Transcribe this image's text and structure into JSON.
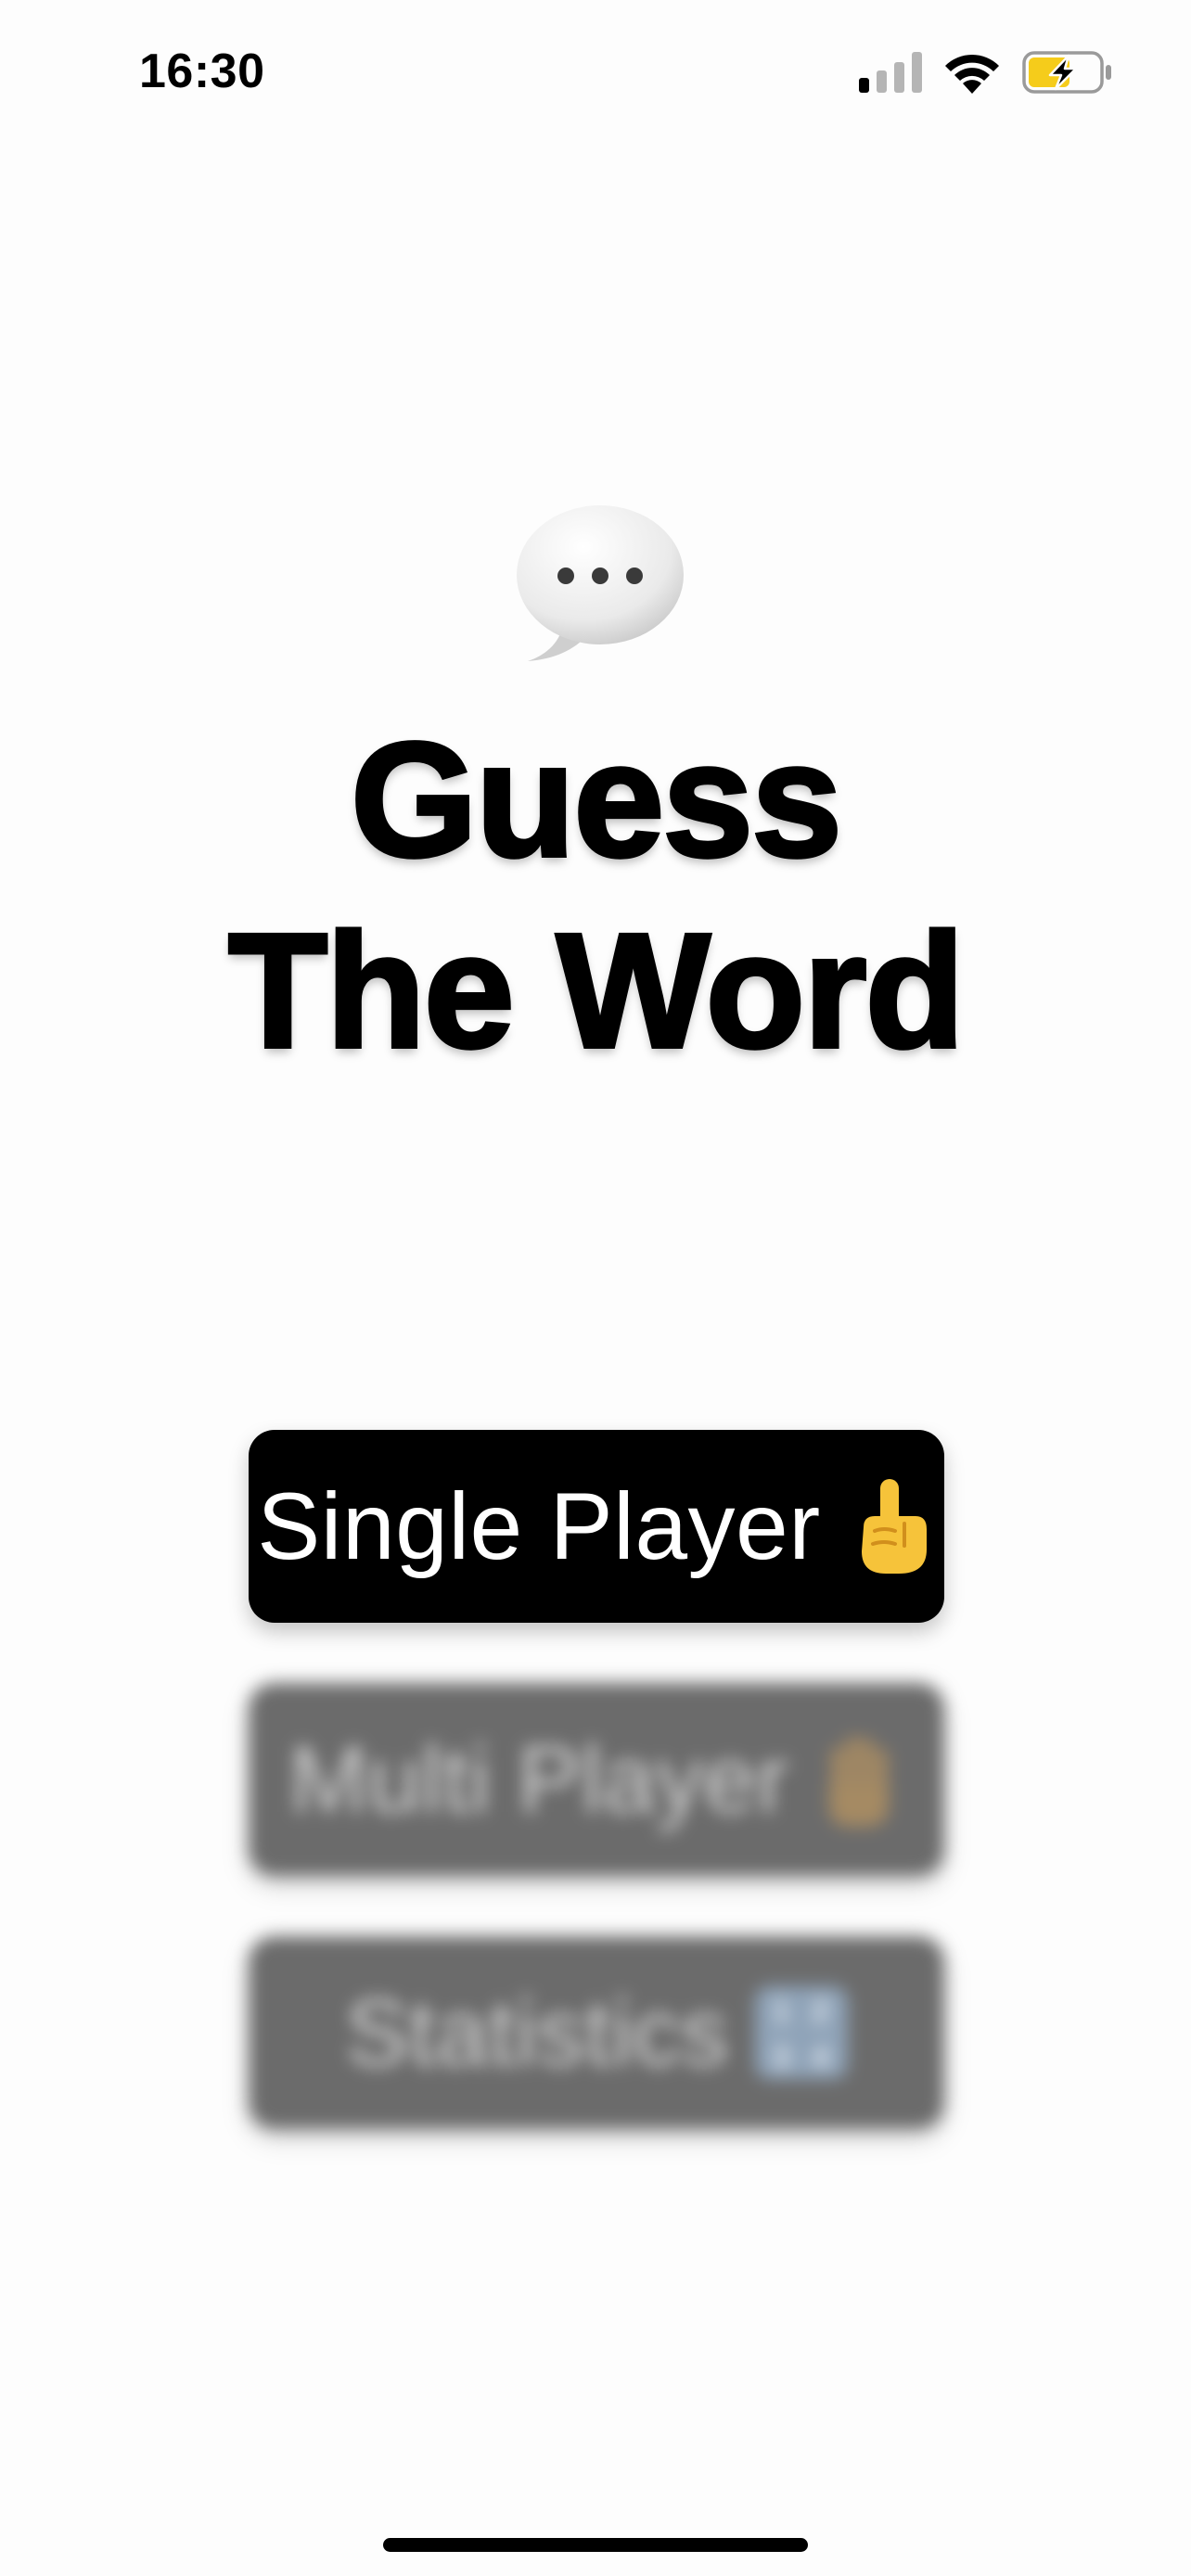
{
  "status_bar": {
    "time": "16:30",
    "icons": [
      "cellular-signal-icon",
      "wifi-icon",
      "battery-charging-icon"
    ],
    "battery_color": "#f5cc1b"
  },
  "hero": {
    "icon": "speech-bubble-icon",
    "title_line1": "Guess",
    "title_line2": "The Word"
  },
  "menu": {
    "single_player_label": "Single Player",
    "single_player_icon": "pointing-up-hand-icon",
    "multi_player_label": "Multi Player",
    "multi_player_icon": "raised-hand-icon",
    "statistics_label": "Statistics",
    "statistics_icon": "numbers-input-icon",
    "statistics_icon_digits": [
      "1",
      "2",
      "3",
      "4"
    ]
  },
  "colors": {
    "primary_button": "#000000",
    "disabled_button": "#6b6b6b",
    "background": "#fdfdfd"
  }
}
